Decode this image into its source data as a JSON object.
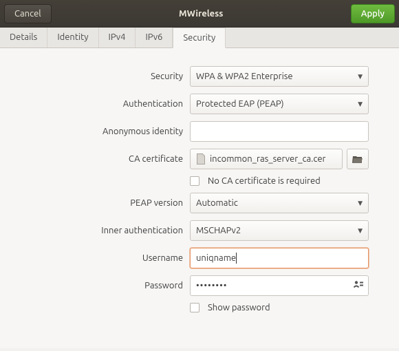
{
  "titlebar": {
    "cancel": "Cancel",
    "title": "MWireless",
    "apply": "Apply"
  },
  "tabs": [
    "Details",
    "Identity",
    "IPv4",
    "IPv6",
    "Security"
  ],
  "active_tab": 4,
  "form": {
    "security": {
      "label": "Security",
      "value": "WPA & WPA2 Enterprise"
    },
    "authentication": {
      "label": "Authentication",
      "value": "Protected EAP (PEAP)"
    },
    "anonymous": {
      "label": "Anonymous identity",
      "value": ""
    },
    "ca_cert": {
      "label": "CA certificate",
      "filename": "incommon_ras_server_ca.cer"
    },
    "no_ca": {
      "label": "No CA certificate is required",
      "checked": false
    },
    "peap_version": {
      "label": "PEAP version",
      "value": "Automatic"
    },
    "inner_auth": {
      "label": "Inner authentication",
      "value": "MSCHAPv2"
    },
    "username": {
      "label": "Username",
      "value": "uniqname"
    },
    "password": {
      "label": "Password",
      "value": "••••••••"
    },
    "show_password": {
      "label": "Show password",
      "checked": false
    }
  }
}
